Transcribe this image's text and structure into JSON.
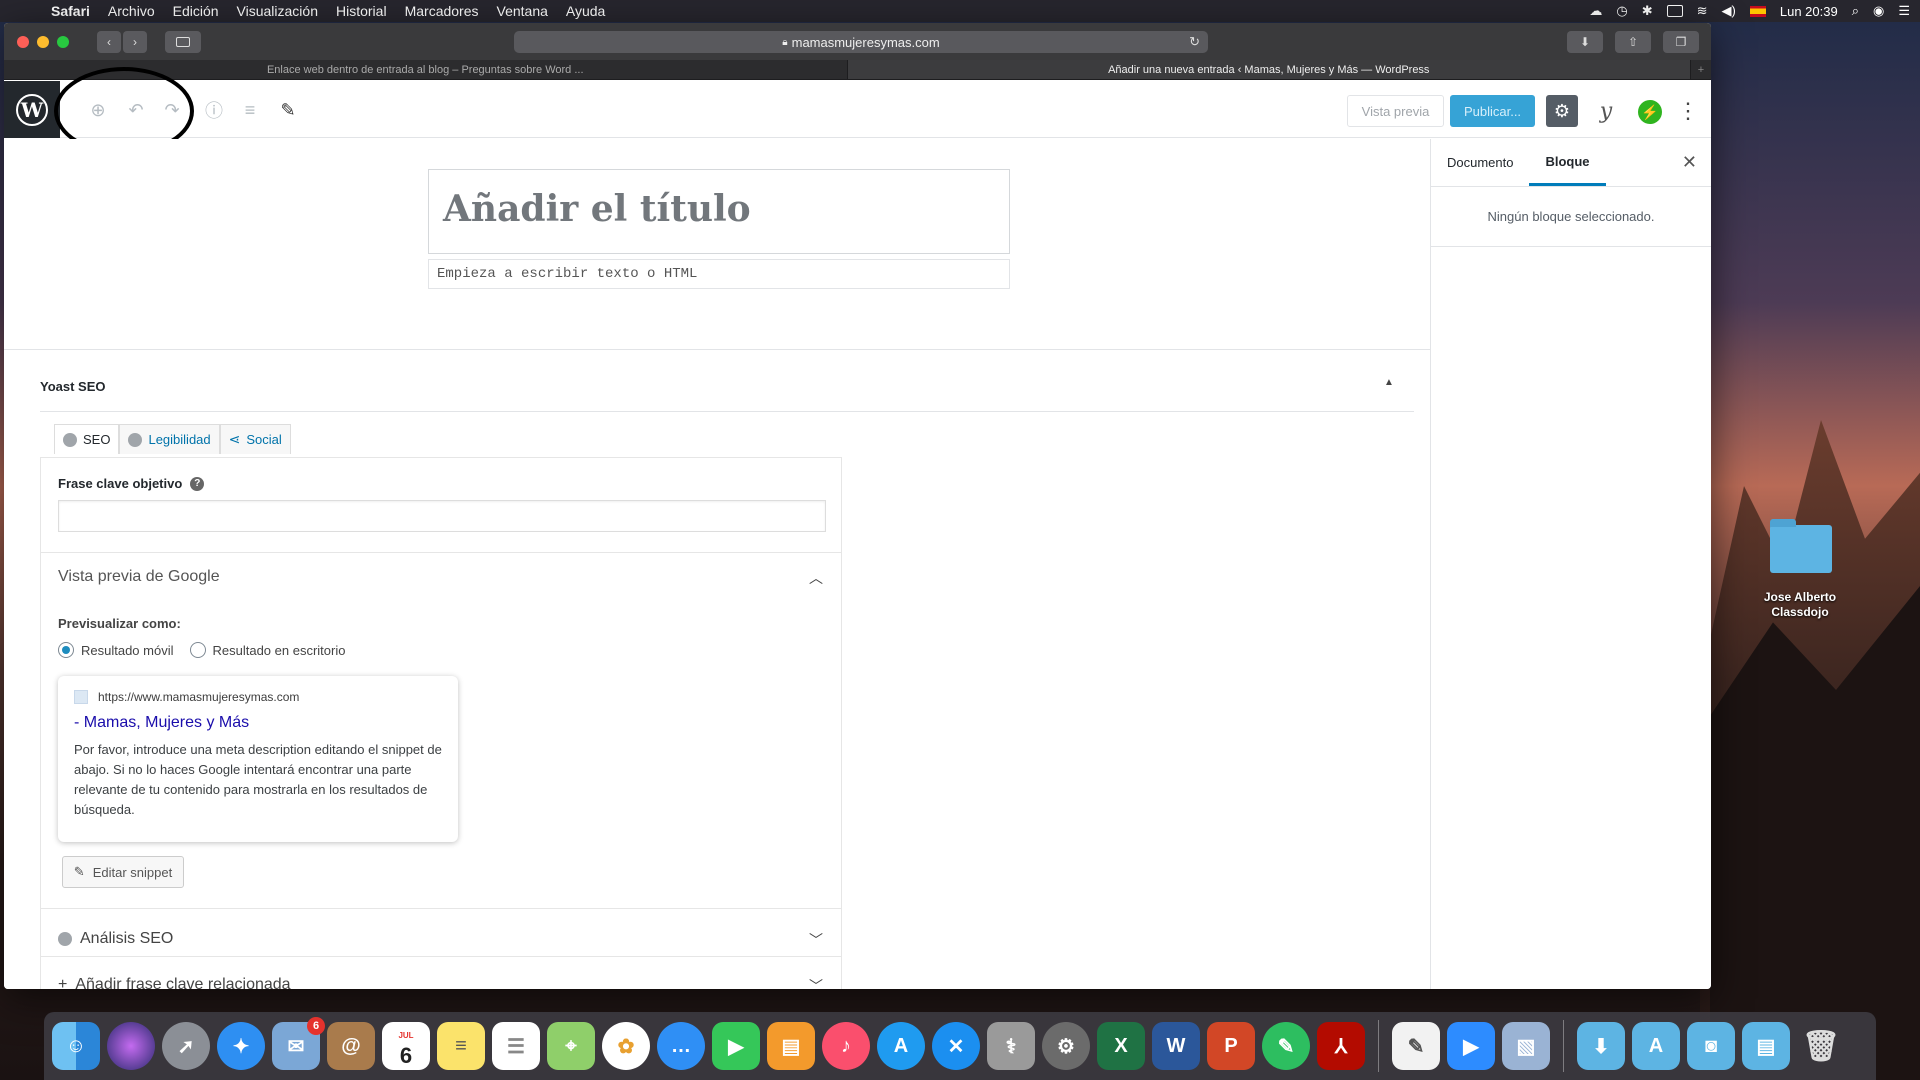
{
  "menubar": {
    "app": "Safari",
    "items": [
      "Archivo",
      "Edición",
      "Visualización",
      "Historial",
      "Marcadores",
      "Ventana",
      "Ayuda"
    ],
    "clock": "Lun 20:39"
  },
  "browser": {
    "url": "mamasmujeresymas.com",
    "tabs": [
      {
        "title": "Enlace web dentro de entrada al blog – Preguntas sobre Word ..."
      },
      {
        "title": "Añadir una nueva entrada ‹ Mamas, Mujeres y Más — WordPress"
      }
    ]
  },
  "wp_toolbar": {
    "preview_label": "Vista previa",
    "publish_label": "Publicar..."
  },
  "editor": {
    "title_placeholder": "Añadir el título",
    "text_placeholder": "Empieza a escribir texto o HTML"
  },
  "yoast": {
    "heading": "Yoast SEO",
    "tabs": {
      "seo": "SEO",
      "readability": "Legibilidad",
      "social": "Social"
    },
    "focus_keyphrase_label": "Frase clave objetivo",
    "help_glyph": "?",
    "google_preview_title": "Vista previa de Google",
    "preview_as_label": "Previsualizar como:",
    "radio_mobile": "Resultado móvil",
    "radio_desktop": "Resultado en escritorio",
    "snippet": {
      "url": "https://www.mamasmujeresymas.com",
      "title": "- Mamas, Mujeres y Más",
      "description": "Por favor, introduce una meta description editando el snippet de abajo. Si no lo haces Google intentará encontrar una parte relevante de tu contenido para mostrarla en los resultados de búsqueda."
    },
    "edit_snippet_label": "Editar snippet",
    "seo_analysis": "Análisis SEO",
    "add_related": "Añadir frase clave relacionada"
  },
  "sidebar": {
    "tab_document": "Documento",
    "tab_block": "Bloque",
    "empty_message": "Ningún bloque seleccionado."
  },
  "desktop": {
    "folder_label": "Jose Alberto Classdojo"
  },
  "dock": {
    "calendar_month": "JUL",
    "calendar_day": "6",
    "mail_badge": "6"
  },
  "colors": {
    "accent": "#007cba",
    "publish": "#36a3d6",
    "wp_dark": "#23282d"
  }
}
